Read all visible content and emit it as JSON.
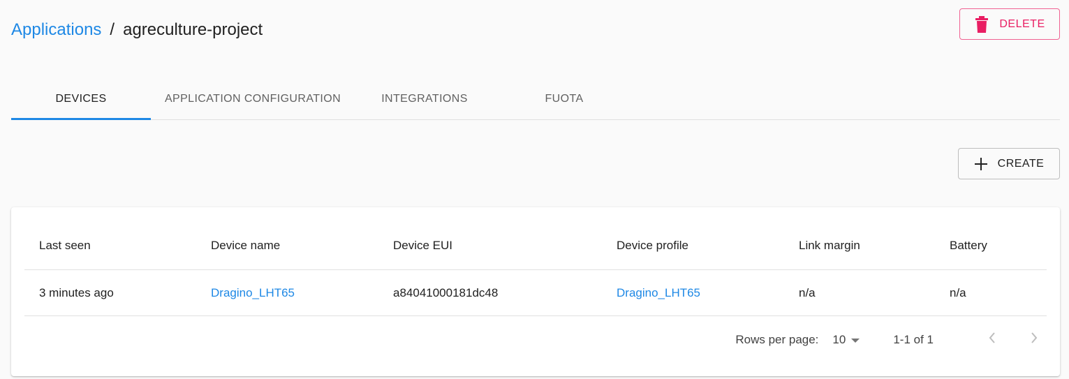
{
  "breadcrumb": {
    "parent": "Applications",
    "separator": "/",
    "current": "agreculture-project"
  },
  "actions": {
    "delete_label": "DELETE",
    "create_label": "CREATE"
  },
  "tabs": [
    {
      "label": "DEVICES",
      "active": true
    },
    {
      "label": "APPLICATION CONFIGURATION",
      "active": false
    },
    {
      "label": "INTEGRATIONS",
      "active": false
    },
    {
      "label": "FUOTA",
      "active": false
    }
  ],
  "table": {
    "headers": [
      "Last seen",
      "Device name",
      "Device EUI",
      "Device profile",
      "Link margin",
      "Battery"
    ],
    "rows": [
      {
        "last_seen": "3 minutes ago",
        "device_name": "Dragino_LHT65",
        "device_eui": "a84041000181dc48",
        "device_profile": "Dragino_LHT65",
        "link_margin": "n/a",
        "battery": "n/a"
      }
    ]
  },
  "pagination": {
    "rows_per_page_label": "Rows per page:",
    "rows_per_page": "10",
    "range": "1-1 of 1"
  },
  "colors": {
    "accent": "#1e88e5",
    "danger": "#e91e63"
  },
  "icons": {
    "delete": "trash-icon",
    "create": "plus-icon",
    "dropdown": "caret-down-icon",
    "prev": "chevron-left-icon",
    "next": "chevron-right-icon"
  }
}
